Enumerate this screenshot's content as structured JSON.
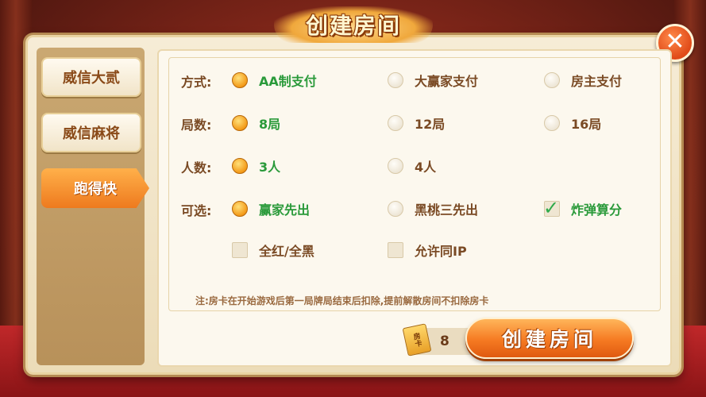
{
  "title": "创建房间",
  "sidebar": {
    "tabs": [
      {
        "label": "威信大贰",
        "active": false
      },
      {
        "label": "威信麻将",
        "active": false
      },
      {
        "label": "跑得快",
        "active": true
      }
    ]
  },
  "rows": {
    "mode": {
      "label": "方式:",
      "options": [
        {
          "label": "AA制支付",
          "selected": true
        },
        {
          "label": "大赢家支付",
          "selected": false
        },
        {
          "label": "房主支付",
          "selected": false
        }
      ]
    },
    "rounds": {
      "label": "局数:",
      "options": [
        {
          "label": "8局",
          "selected": true
        },
        {
          "label": "12局",
          "selected": false
        },
        {
          "label": "16局",
          "selected": false
        }
      ]
    },
    "players": {
      "label": "人数:",
      "options": [
        {
          "label": "3人",
          "selected": true
        },
        {
          "label": "4人",
          "selected": false
        }
      ]
    },
    "optional": {
      "label": "可选:",
      "options": [
        {
          "label": "赢家先出",
          "selected": true
        },
        {
          "label": "黑桃三先出",
          "selected": false
        }
      ],
      "checks": [
        {
          "label": "炸弹算分",
          "checked": true
        },
        {
          "label": "全红/全黑",
          "checked": false
        },
        {
          "label": "允许同IP",
          "checked": false
        }
      ]
    }
  },
  "note": "注:房卡在开始游戏后第一局牌局结束后扣除,提前解散房间不扣除房卡",
  "room_card": {
    "icon_text": "房卡",
    "count": "8"
  },
  "create_button": "创建房间",
  "colors": {
    "accent": "#f57a22",
    "selected_text": "#2a9a3a",
    "label_text": "#7a4a24"
  }
}
